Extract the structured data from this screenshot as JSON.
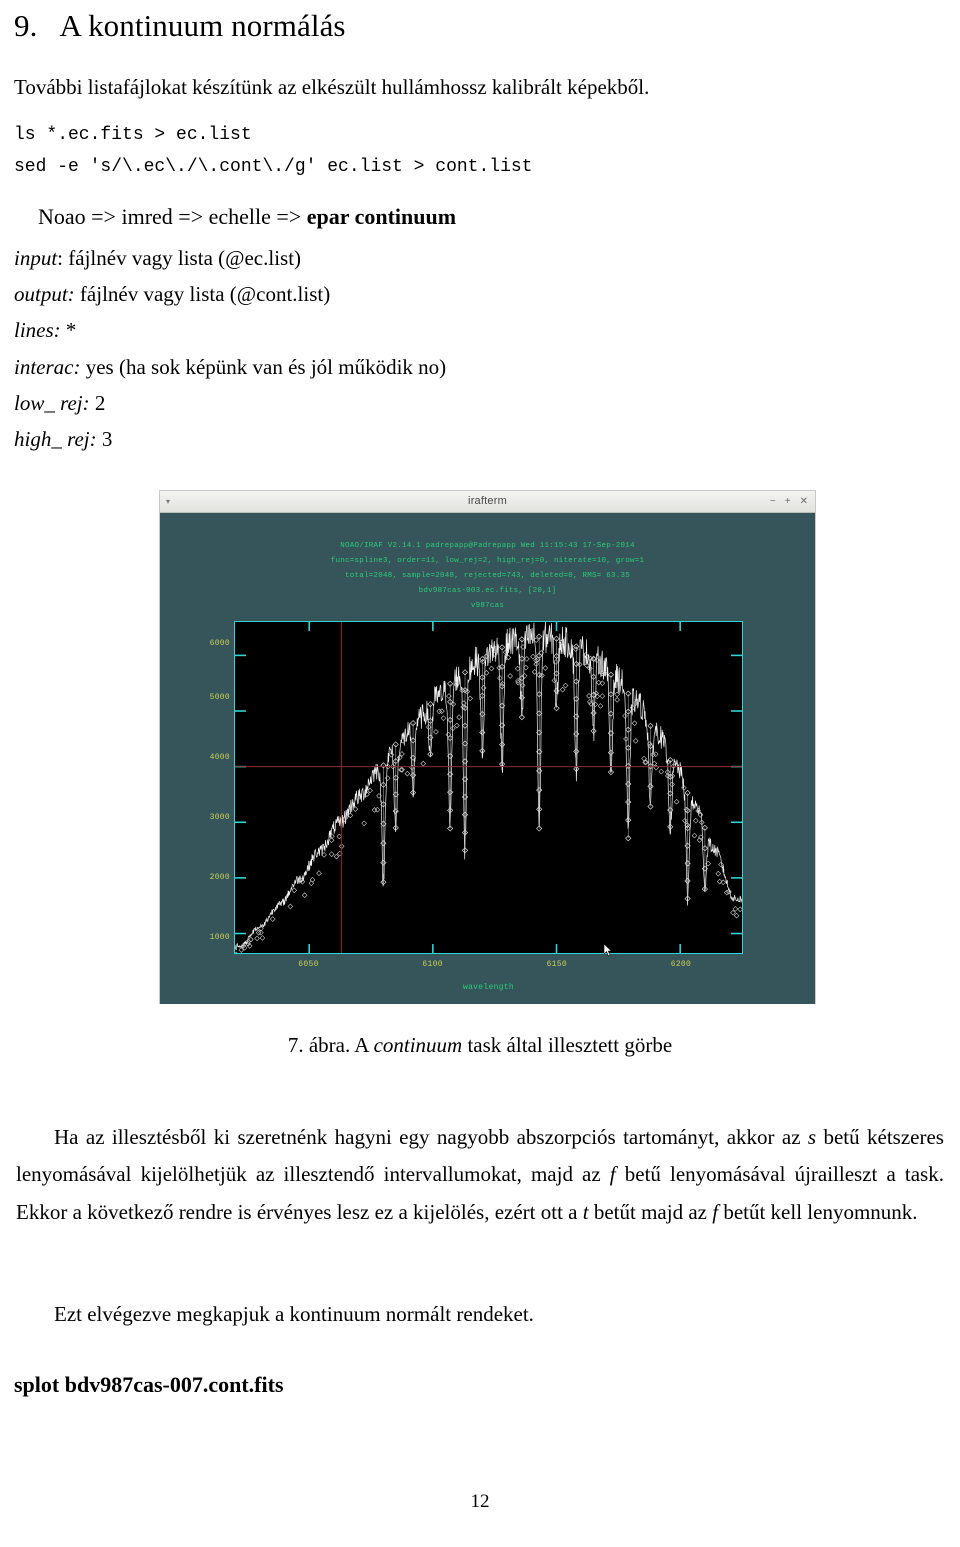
{
  "document": {
    "section_number": "9.",
    "section_title": "A kontinuum normálás",
    "intro": "További listafájlokat készítünk az elkészült hullámhossz kalibrált képekből.",
    "commands": [
      "ls *.ec.fits > ec.list",
      "sed -e 's/\\.ec\\./\\.cont\\./g' ec.list > cont.list"
    ],
    "menu_path": "Noao => imred => echelle => ",
    "menu_path_bold": "epar continuum",
    "parameters": [
      {
        "key": "input",
        "sep": ": ",
        "value": "fájlnév vagy lista (@ec.list)"
      },
      {
        "key": "output:",
        "sep": " ",
        "value": "fájlnév vagy lista (@cont.list)"
      },
      {
        "key": "lines:",
        "sep": " ",
        "value": "*"
      },
      {
        "key": "interac:",
        "sep": " ",
        "value": "yes (ha sok képünk van és jól működik no)"
      },
      {
        "key": "low_ rej:",
        "sep": " ",
        "value": "2"
      },
      {
        "key": "high_ rej:",
        "sep": " ",
        "value": "3"
      }
    ],
    "figure_caption_prefix": "7. ábra. A ",
    "figure_caption_italic": "continuum",
    "figure_caption_suffix": " task által illesztett görbe",
    "paragraph_1_a": "Ha az illesztésből ki szeretnénk hagyni egy nagyobb abszorpciós tartományt, akkor az ",
    "paragraph_1_s": "s",
    "paragraph_1_b": " betű kétszeres lenyomásával kijelölhetjük az illesztendő intervallumokat, majd az ",
    "paragraph_1_f": "f",
    "paragraph_1_c": " betű lenyomásával újrailleszt a task. Ekkor a következő rendre is érvényes lesz ez a kijelölés, ezért ott a ",
    "paragraph_1_t": "t",
    "paragraph_1_d": " betűt majd az ",
    "paragraph_1_f2": "f",
    "paragraph_1_e": " betűt kell lenyomnunk.",
    "paragraph_2": "Ezt elvégezve megkapjuk a kontinuum normált rendeket.",
    "final_command": "splot bdv987cas-007.cont.fits",
    "page_number": "12"
  },
  "window": {
    "title": "irafterm",
    "menu_icon": "▾",
    "minimize_label": "−",
    "maximize_label": "+",
    "close_label": "✕",
    "colors": {
      "window_bg": "#35555a",
      "titlebar_bg": "#f0f0ee",
      "plot_bg": "#000000",
      "axis": "#2fd6d6",
      "header_text": "#2ecb7a",
      "tick_text": "#c9cf56",
      "crosshair": "#8b2f2f",
      "data": "#ffffff"
    },
    "header_lines": [
      "NOAO/IRAF V2.14.1 padrepapp@Padrepapp Wed 11:15:43 17-Sep-2014",
      "func=spline3, order=11, low_rej=2, high_rej=0, niterate=10, grow=1",
      "total=2048, sample=2048, rejected=743, deleted=0, RMS=  63.35",
      "bdv987cas-003.ec.fits, [20,1]",
      "v987cas"
    ]
  },
  "chart_data": {
    "type": "line",
    "title": "bdv987cas-003.ec.fits, [20,1]",
    "subtitle": "v987cas",
    "xlabel": "wavelength",
    "ylabel": "",
    "x_ticks": [
      6050,
      6100,
      6150,
      6200
    ],
    "y_ticks": [
      1000,
      2000,
      3000,
      4000,
      5000,
      6000
    ],
    "xlim": [
      6020,
      6225
    ],
    "ylim": [
      650,
      6600
    ],
    "grid": false,
    "legend": null,
    "crosshair": {
      "x": 6063,
      "y": 4000
    },
    "fit": {
      "function": "spline3",
      "order": 11,
      "low_rej": 2,
      "high_rej": 0,
      "niterate": 10,
      "grow": 1,
      "total": 2048,
      "sample": 2048,
      "rejected": 743,
      "deleted": 0,
      "rms": 63.35
    },
    "continuum_envelope": [
      {
        "x": 6022,
        "y": 760
      },
      {
        "x": 6030,
        "y": 1120
      },
      {
        "x": 6038,
        "y": 1520
      },
      {
        "x": 6046,
        "y": 1980
      },
      {
        "x": 6054,
        "y": 2470
      },
      {
        "x": 6062,
        "y": 2980
      },
      {
        "x": 6070,
        "y": 3450
      },
      {
        "x": 6078,
        "y": 3950
      },
      {
        "x": 6086,
        "y": 4420
      },
      {
        "x": 6094,
        "y": 4850
      },
      {
        "x": 6102,
        "y": 5250
      },
      {
        "x": 6110,
        "y": 5600
      },
      {
        "x": 6118,
        "y": 5900
      },
      {
        "x": 6126,
        "y": 6120
      },
      {
        "x": 6134,
        "y": 6280
      },
      {
        "x": 6142,
        "y": 6340
      },
      {
        "x": 6150,
        "y": 6300
      },
      {
        "x": 6158,
        "y": 6160
      },
      {
        "x": 6166,
        "y": 5930
      },
      {
        "x": 6174,
        "y": 5600
      },
      {
        "x": 6182,
        "y": 5180
      },
      {
        "x": 6190,
        "y": 4650
      },
      {
        "x": 6198,
        "y": 4020
      },
      {
        "x": 6206,
        "y": 3300
      },
      {
        "x": 6214,
        "y": 2500
      },
      {
        "x": 6222,
        "y": 1620
      }
    ],
    "absorption_lines": [
      {
        "x": 6080,
        "depth": 2100
      },
      {
        "x": 6085,
        "depth": 1500
      },
      {
        "x": 6092,
        "depth": 1250
      },
      {
        "x": 6099,
        "depth": 900
      },
      {
        "x": 6107,
        "depth": 2600
      },
      {
        "x": 6113,
        "depth": 3200
      },
      {
        "x": 6120,
        "depth": 1650
      },
      {
        "x": 6128,
        "depth": 2100
      },
      {
        "x": 6136,
        "depth": 1400
      },
      {
        "x": 6143,
        "depth": 3450
      },
      {
        "x": 6150,
        "depth": 1250
      },
      {
        "x": 6158,
        "depth": 2200
      },
      {
        "x": 6165,
        "depth": 1300
      },
      {
        "x": 6172,
        "depth": 1750
      },
      {
        "x": 6179,
        "depth": 2600
      },
      {
        "x": 6188,
        "depth": 1450
      },
      {
        "x": 6196,
        "depth": 1200
      },
      {
        "x": 6203,
        "depth": 1900
      },
      {
        "x": 6210,
        "depth": 1100
      }
    ]
  }
}
